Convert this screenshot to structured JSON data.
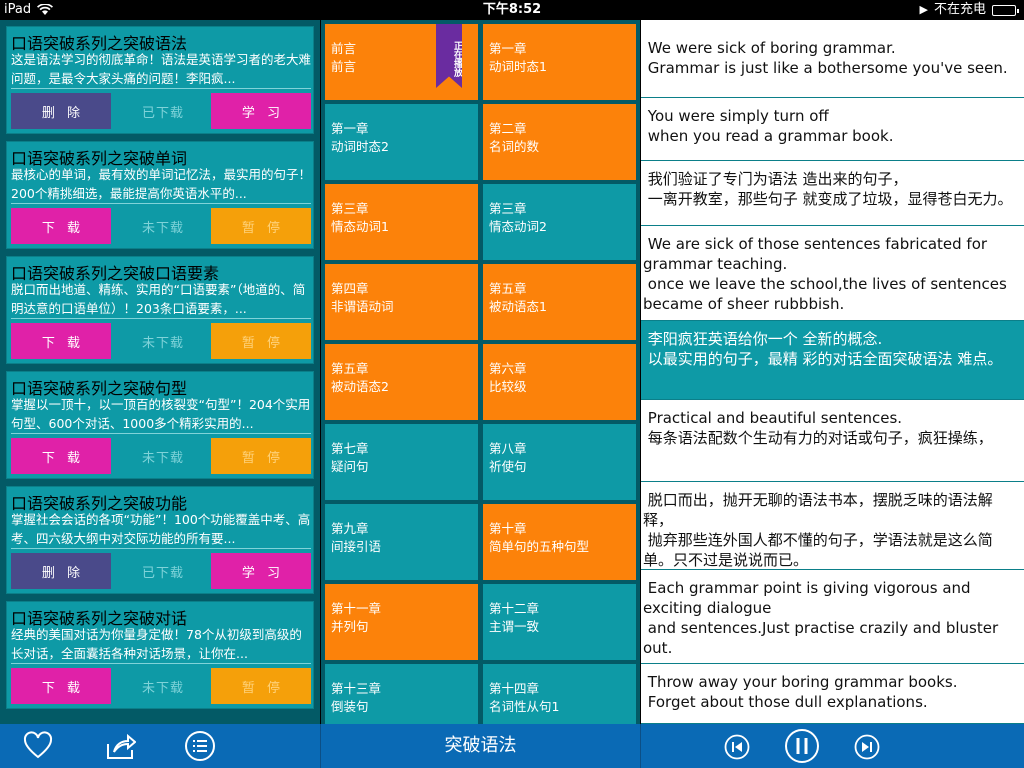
{
  "status": {
    "device": "iPad",
    "time": "下午8:52",
    "battery_text": "不在充电"
  },
  "left_cards": [
    {
      "title": "口语突破系列之突破语法",
      "desc": "这是语法学习的彻底革命！语法是英语学习者的老大难问题，是最令大家头痛的问题！李阳疯...",
      "buttons": [
        "删 除",
        "已下载",
        "学 习"
      ]
    },
    {
      "title": "口语突破系列之突破单词",
      "desc": "最核心的单词，最有效的单词记忆法，最实用的句子！200个精挑细选，最能提高你英语水平的...",
      "buttons": [
        "下 载",
        "未下载",
        "暂 停"
      ]
    },
    {
      "title": "口语突破系列之突破口语要素",
      "desc": "脱口而出地道、精练、实用的“口语要素”（地道的、简明达意的口语单位）！203条口语要素，...",
      "buttons": [
        "下 载",
        "未下载",
        "暂 停"
      ]
    },
    {
      "title": "口语突破系列之突破句型",
      "desc": "掌握以一顶十，以一顶百的核裂变“句型”！204个实用句型、600个对话、1000多个精彩实用的...",
      "buttons": [
        "下 载",
        "未下载",
        "暂 停"
      ]
    },
    {
      "title": "口语突破系列之突破功能",
      "desc": "掌握社会会话的各项“功能”！100个功能覆盖中考、高考、四六级大纲中对交际功能的所有要...",
      "buttons": [
        "删 除",
        "已下载",
        "学 习"
      ]
    },
    {
      "title": "口语突破系列之突破对话",
      "desc": "经典的美国对话为你量身定做！78个从初级到高级的长对话，全面囊括各种对话场景，让你在...",
      "buttons": [
        "下 载",
        "未下载",
        "暂 停"
      ]
    }
  ],
  "chapters": [
    {
      "l1": "前言",
      "l2": "前言",
      "color": "orange",
      "ribbon": "正在播放"
    },
    {
      "l1": "第一章",
      "l2": "动词时态1",
      "color": "orange"
    },
    {
      "l1": "第一章",
      "l2": "动词时态2",
      "color": "cyan"
    },
    {
      "l1": "第二章",
      "l2": "名词的数",
      "color": "orange"
    },
    {
      "l1": "第三章",
      "l2": "情态动词1",
      "color": "orange"
    },
    {
      "l1": "第三章",
      "l2": "情态动词2",
      "color": "cyan"
    },
    {
      "l1": "第四章",
      "l2": "非谓语动词",
      "color": "orange"
    },
    {
      "l1": "第五章",
      "l2": "被动语态1",
      "color": "orange"
    },
    {
      "l1": "第五章",
      "l2": "被动语态2",
      "color": "orange"
    },
    {
      "l1": "第六章",
      "l2": "比较级",
      "color": "orange"
    },
    {
      "l1": "第七章",
      "l2": "疑问句",
      "color": "cyan"
    },
    {
      "l1": "第八章",
      "l2": "祈使句",
      "color": "cyan"
    },
    {
      "l1": "第九章",
      "l2": "间接引语",
      "color": "cyan"
    },
    {
      "l1": "第十章",
      "l2": "简单句的五种句型",
      "color": "orange"
    },
    {
      "l1": "第十一章",
      "l2": "并列句",
      "color": "orange"
    },
    {
      "l1": "第十二章",
      "l2": "主谓一致",
      "color": "cyan"
    },
    {
      "l1": "第十三章",
      "l2": "倒装句",
      "color": "cyan"
    },
    {
      "l1": "第十四章",
      "l2": "名词性从句1",
      "color": "cyan"
    }
  ],
  "sentences": [
    {
      "text": " We were sick of boring grammar.\n Grammar is just like a bothersome you've seen.",
      "hl": false
    },
    {
      "text": " You were simply turn off\n when you read a grammar book.",
      "hl": false
    },
    {
      "text": " 我们验证了专门为语法 造出来的句子，\n 一离开教室，那些句子 就变成了垃圾，显得苍白无力。",
      "hl": false
    },
    {
      "text": " We are sick of those sentences fabricated for grammar teaching.\n once we leave the school,the lives of sentences became of sheer rubbbish.",
      "hl": false
    },
    {
      "text": " 李阳疯狂英语给你一个 全新的概念.\n 以最实用的句子，最精 彩的对话全面突破语法 难点。",
      "hl": true
    },
    {
      "text": " Practical and beautiful sentences.\n 每条语法配数个生动有力的对话或句子，疯狂操练，",
      "hl": false
    },
    {
      "text": " 脱口而出，抛开无聊的语法书本，摆脱乏味的语法解释，\n 抛弃那些连外国人都不懂的句子，学语法就是这么简单。只不过是说说而已。",
      "hl": false
    },
    {
      "text": " Each grammar point is giving vigorous and exciting dialogue\n and sentences.Just practise crazily and bluster out.",
      "hl": false
    },
    {
      "text": " Throw away your boring grammar books.\n Forget about those dull explanations.",
      "hl": false
    }
  ],
  "toolbar": {
    "title": "突破语法"
  },
  "colors": {
    "orange": "#fc820a",
    "cyan": "#0e9aa6",
    "navy": "#035a66",
    "magenta": "#e021a8",
    "purple": "#4a4a8a",
    "blue": "#0a6ab5"
  },
  "icons": [
    "heart-icon",
    "share-icon",
    "list-icon",
    "previous-icon",
    "pause-icon",
    "next-icon"
  ]
}
